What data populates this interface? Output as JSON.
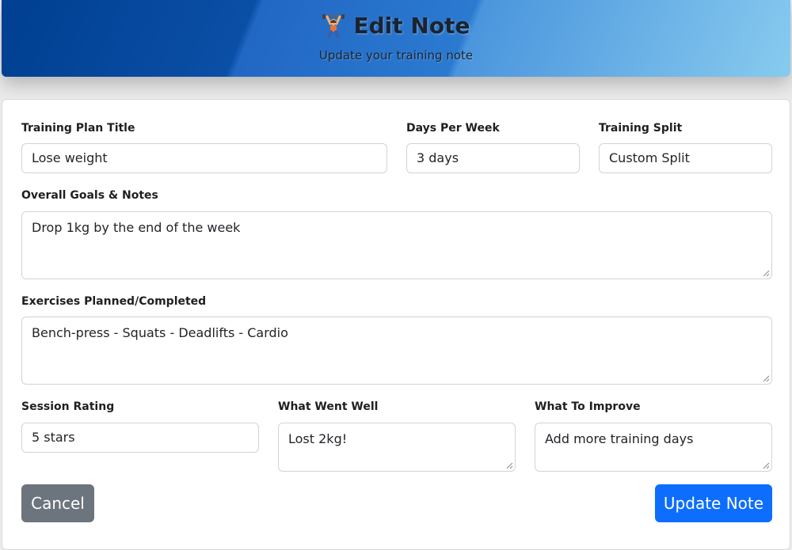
{
  "header": {
    "title": "Edit Note",
    "subtitle": "Update your training note",
    "icon": "weightlifter-icon"
  },
  "form": {
    "title": {
      "label": "Training Plan Title",
      "value": "Lose weight"
    },
    "days": {
      "label": "Days Per Week",
      "value": "3 days"
    },
    "split": {
      "label": "Training Split",
      "value": "Custom Split"
    },
    "goals": {
      "label": "Overall Goals & Notes",
      "value": "Drop 1kg by the end of the week"
    },
    "exercises": {
      "label": "Exercises Planned/Completed",
      "value": "Bench-press - Squats - Deadlifts - Cardio"
    },
    "rating": {
      "label": "Session Rating",
      "value": "5 stars"
    },
    "went_well": {
      "label": "What Went Well",
      "value": "Lost 2kg!"
    },
    "improve": {
      "label": "What To Improve",
      "value": "Add more training days"
    }
  },
  "actions": {
    "cancel_label": "Cancel",
    "update_label": "Update Note"
  },
  "colors": {
    "cancel": "#6c757d",
    "primary": "#0d6efd",
    "header_dark": "#003f91",
    "header_light": "#88cbef"
  }
}
